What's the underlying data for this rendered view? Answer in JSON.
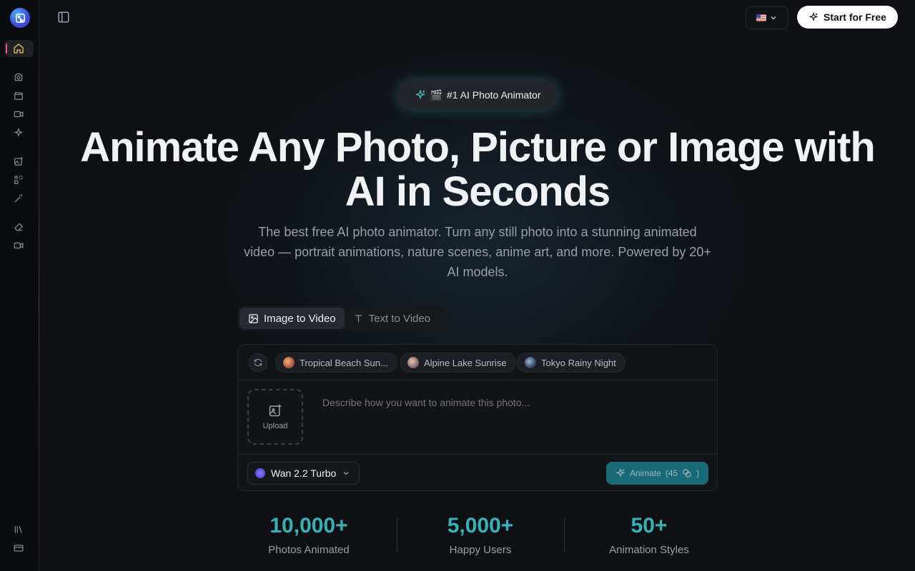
{
  "sidebar": {
    "icons": [
      "home-icon",
      "camera-icon",
      "clapperboard-icon",
      "video-icon",
      "sparkles-icon",
      "image-plus-icon",
      "shapes-icon",
      "magic-wand-icon",
      "eraser-icon",
      "video-camera-icon",
      "library-icon",
      "credit-card-icon"
    ]
  },
  "topbar": {
    "start_label": "Start for Free"
  },
  "hero": {
    "badge": "#1 AI Photo Animator",
    "badge_emoji": "🎬",
    "title_line1": "Animate Any Photo, Picture or Image with",
    "title_line2": "AI in Seconds",
    "subtitle": "The best free AI photo animator. Turn any still photo into a stunning animated video — portrait animations, nature scenes, anime art, and more. Powered by 20+ AI models."
  },
  "tabs": [
    {
      "label": "Image to Video",
      "active": true
    },
    {
      "label": "Text to Video",
      "active": false
    }
  ],
  "presets": [
    {
      "label": "Tropical Beach Sun..."
    },
    {
      "label": "Alpine Lake Sunrise"
    },
    {
      "label": "Tokyo Rainy Night"
    }
  ],
  "composer": {
    "upload_label": "Upload",
    "prompt_placeholder": "Describe how you want to animate this photo...",
    "model_label": "Wan 2.2 Turbo",
    "animate_label": "Animate",
    "animate_cost": "(45",
    "animate_close": ")"
  },
  "stats": [
    {
      "value": "10,000+",
      "label": "Photos Animated"
    },
    {
      "value": "5,000+",
      "label": "Happy Users"
    },
    {
      "value": "50+",
      "label": "Animation Styles"
    }
  ],
  "colors": {
    "accent": "#36b1b5",
    "animate_button": "#1b8796",
    "home_active": "#f3c35c"
  }
}
